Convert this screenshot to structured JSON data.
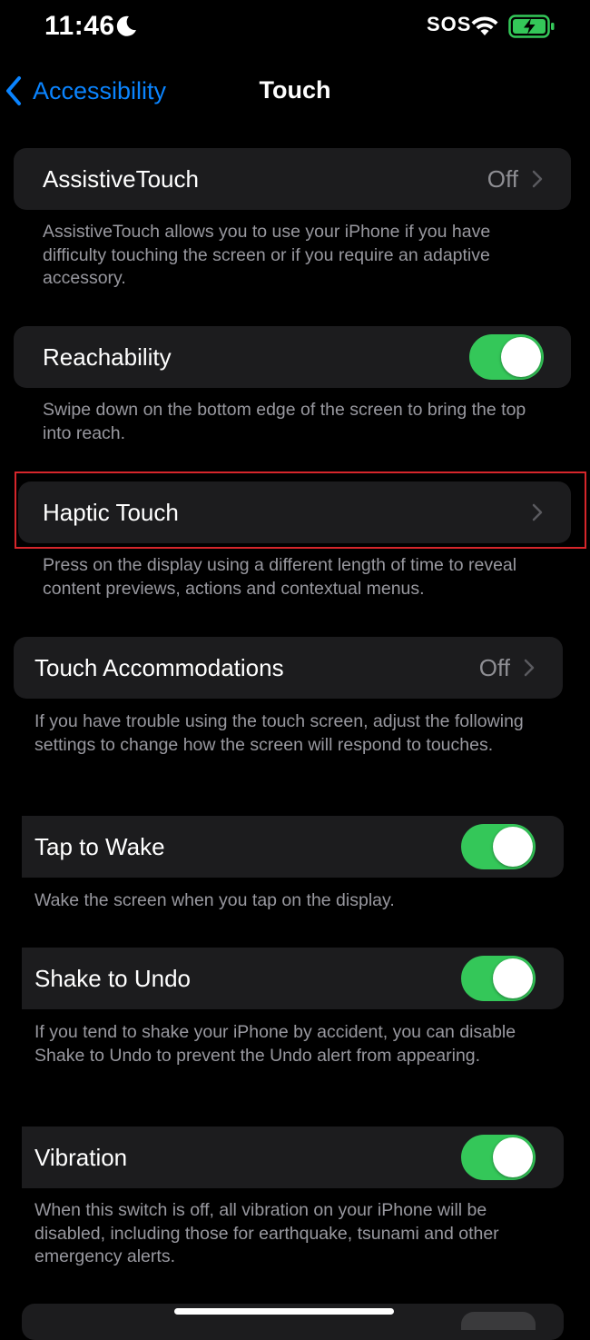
{
  "status_bar": {
    "time": "11:46",
    "carrier": "SOS"
  },
  "nav": {
    "back_label": "Accessibility",
    "title": "Touch"
  },
  "rows": {
    "assistive_touch": {
      "label": "AssistiveTouch",
      "value": "Off",
      "footer": "AssistiveTouch allows you to use your iPhone if you have difficulty touching the screen or if you require an adaptive accessory."
    },
    "reachability": {
      "label": "Reachability",
      "enabled": true,
      "footer": "Swipe down on the bottom edge of the screen to bring the top into reach."
    },
    "haptic_touch": {
      "label": "Haptic Touch",
      "footer": "Press on the display using a different length of time to reveal content previews, actions and contextual menus."
    },
    "touch_accommodations": {
      "label": "Touch Accommodations",
      "value": "Off",
      "footer": "If you have trouble using the touch screen, adjust the following settings to change how the screen will respond to touches."
    },
    "tap_to_wake": {
      "label": "Tap to Wake",
      "enabled": true,
      "footer": "Wake the screen when you tap on the display."
    },
    "shake_to_undo": {
      "label": "Shake to Undo",
      "enabled": true,
      "footer": "If you tend to shake your iPhone by accident, you can disable Shake to Undo to prevent the Undo alert from appearing."
    },
    "vibration": {
      "label": "Vibration",
      "enabled": true,
      "footer": "When this switch is off, all vibration on your iPhone will be disabled, including those for earthquake, tsunami and other emergency alerts."
    }
  },
  "colors": {
    "accent": "#0a84ff",
    "toggle_on": "#34c759",
    "cell_bg": "#1c1c1e",
    "highlight": "#d6262b"
  }
}
